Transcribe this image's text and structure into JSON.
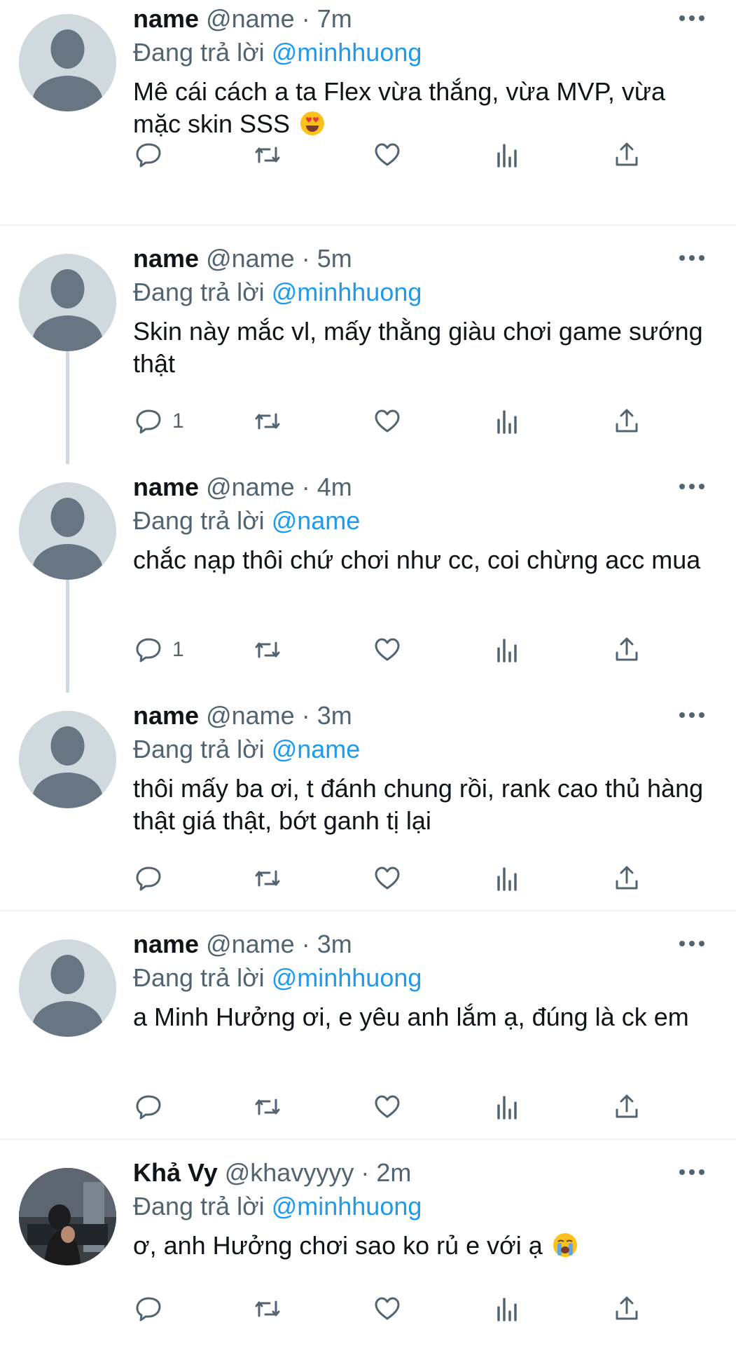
{
  "reply_prefix": "Đang trả lời",
  "tweets": [
    {
      "name": "name",
      "handle": "@name",
      "time": "7m",
      "reply_to": "@minhhuong",
      "text": "Mê cái cách a ta Flex vừa thắng, vừa MVP, vừa mặc skin SSS",
      "emoji": "heart-eyes-emoji",
      "reply_count": "",
      "avatar": "default-avatar"
    },
    {
      "name": "name",
      "handle": "@name",
      "time": "5m",
      "reply_to": "@minhhuong",
      "text": "Skin này mắc vl, mấy thằng giàu chơi game sướng thật",
      "reply_count": "1",
      "avatar": "default-avatar"
    },
    {
      "name": "name",
      "handle": "@name",
      "time": "4m",
      "reply_to": "@name",
      "text": "chắc nạp thôi chứ chơi như cc, coi chừng acc mua",
      "reply_count": "1",
      "avatar": "default-avatar"
    },
    {
      "name": "name",
      "handle": "@name",
      "time": "3m",
      "reply_to": "@name",
      "text": "thôi mấy ba ơi, t đánh chung rồi, rank cao thủ hàng thật giá thật, bớt ganh tị lại",
      "reply_count": "",
      "avatar": "default-avatar"
    },
    {
      "name": "name",
      "handle": "@name",
      "time": "3m",
      "reply_to": "@minhhuong",
      "text": "a Minh Hưởng ơi, e yêu anh lắm ạ, đúng là ck em",
      "reply_count": "",
      "avatar": "default-avatar"
    },
    {
      "name": "Khả Vy",
      "handle": "@khavyyyy",
      "time": "2m",
      "reply_to": "@minhhuong",
      "text": "ơ, anh Hưởng chơi sao ko rủ e với ạ",
      "emoji": "crying-emoji",
      "reply_count": "",
      "avatar": "photo-avatar"
    }
  ],
  "icons": {
    "reply": "reply-icon",
    "retweet": "retweet-icon",
    "like": "like-icon",
    "views": "views-icon",
    "share": "share-icon",
    "more": "more-icon"
  },
  "colors": {
    "text": "#0f1419",
    "muted": "#536471",
    "mention": "#1d9bf0",
    "avatar_bg": "#cfd9de",
    "avatar_fg": "#687684",
    "divider": "#eff3f4"
  }
}
